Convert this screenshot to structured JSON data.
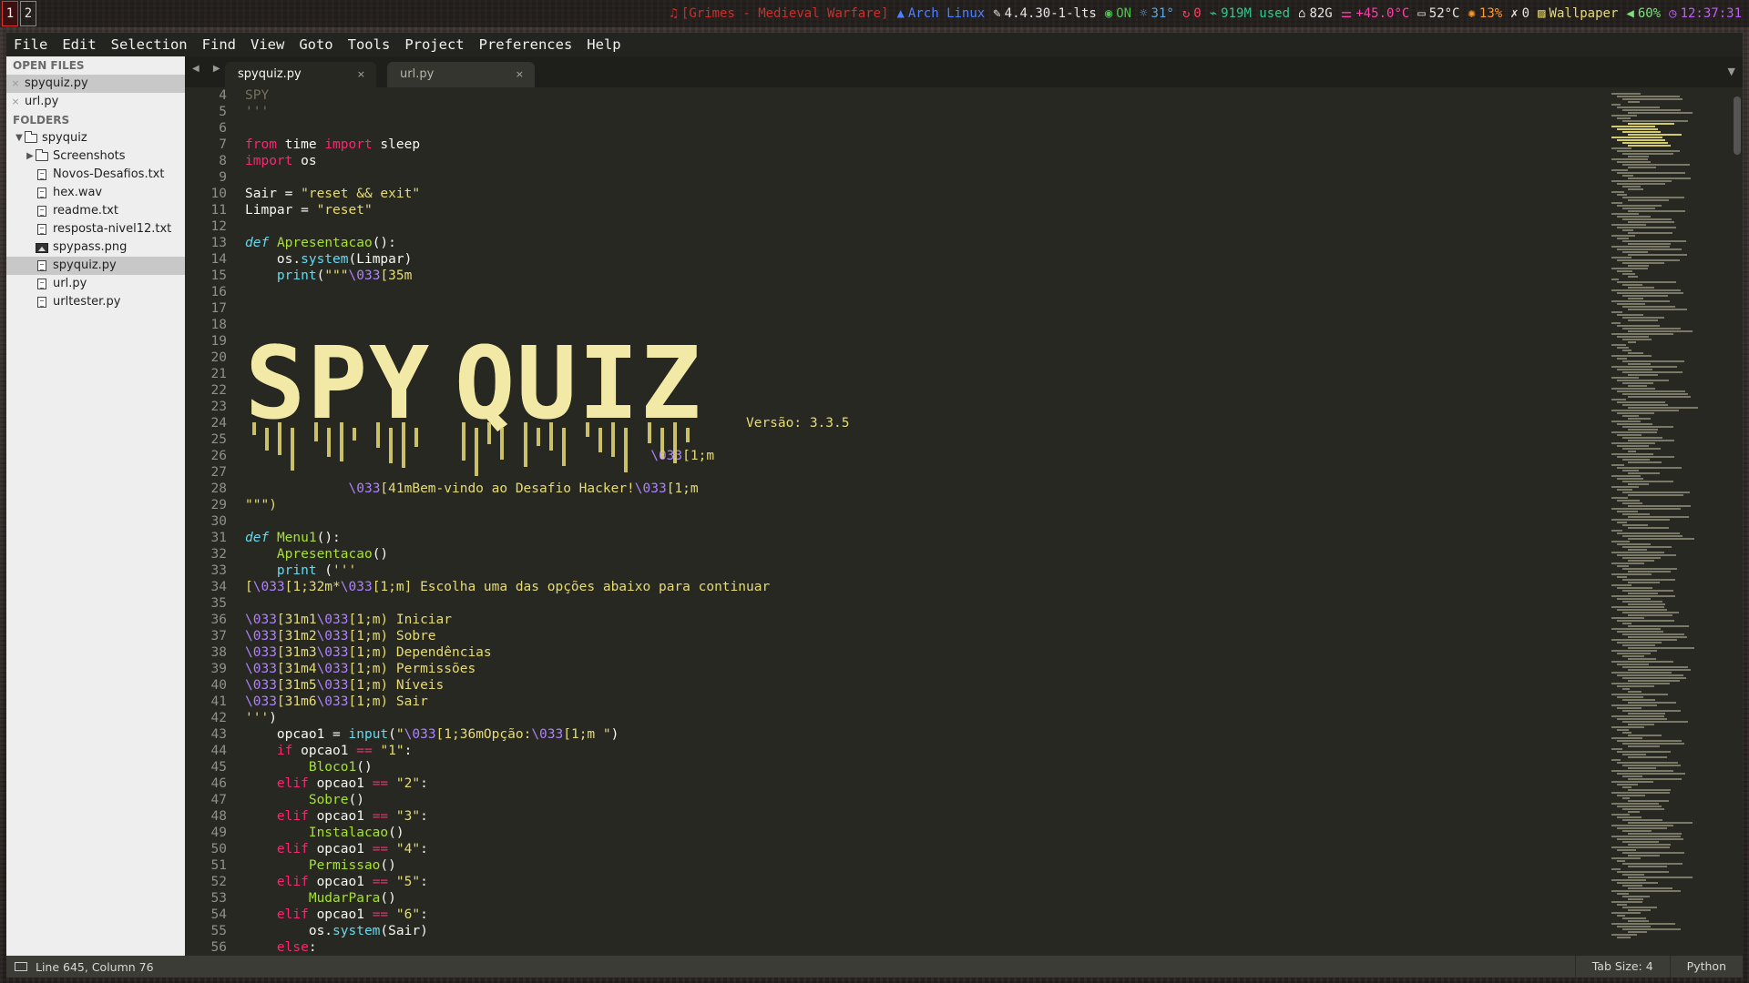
{
  "workspaces": [
    "1",
    "2"
  ],
  "status_bar": [
    {
      "icon": "music-icon",
      "glyph": "♫",
      "text": "[Grimes - Medieval Warfare]",
      "color": "#c9302c"
    },
    {
      "icon": "arch-logo-icon",
      "glyph": "▲",
      "text": "Arch Linux",
      "color": "#4d7fff"
    },
    {
      "icon": "wrench-icon",
      "glyph": "✎",
      "text": "4.4.30-1-lts",
      "color": "#e6e6e6"
    },
    {
      "icon": "globe-icon",
      "glyph": "◉",
      "text": "ON",
      "color": "#4cc34c"
    },
    {
      "icon": "weather-icon",
      "glyph": "☼",
      "text": "31°",
      "color": "#5aa7e0"
    },
    {
      "icon": "updates-icon",
      "glyph": "↻",
      "text": "0",
      "color": "#ff3f5f"
    },
    {
      "icon": "memory-icon",
      "glyph": "⌁",
      "text": "919M used",
      "color": "#35c68a"
    },
    {
      "icon": "home-icon",
      "glyph": "⌂",
      "text": "82G",
      "color": "#e6e6e6"
    },
    {
      "icon": "thermometer-icon",
      "glyph": "⚌",
      "text": "+45.0°C",
      "color": "#ff3fa9"
    },
    {
      "icon": "monitor-icon",
      "glyph": "▭",
      "text": "52°C",
      "color": "#e6e6e6"
    },
    {
      "icon": "cpu-icon",
      "glyph": "✺",
      "text": "13%",
      "color": "#ff9a2e"
    },
    {
      "icon": "trash-icon",
      "glyph": "✗",
      "text": "0",
      "color": "#e6e6e6"
    },
    {
      "icon": "wallpaper-icon",
      "glyph": "▨",
      "text": "Wallpaper",
      "color": "#e6db74"
    },
    {
      "icon": "volume-icon",
      "glyph": "◀",
      "text": "60%",
      "color": "#7ee07e"
    },
    {
      "icon": "clock-icon",
      "glyph": "◷",
      "text": "12:37:31",
      "color": "#c05ef5"
    }
  ],
  "menu": [
    "File",
    "Edit",
    "Selection",
    "Find",
    "View",
    "Goto",
    "Tools",
    "Project",
    "Preferences",
    "Help"
  ],
  "sidebar": {
    "open_files_label": "OPEN FILES",
    "open_files": [
      {
        "name": "spyquiz.py",
        "selected": true
      },
      {
        "name": "url.py",
        "selected": false
      }
    ],
    "folders_label": "FOLDERS",
    "root_folder": "spyquiz",
    "items": [
      {
        "name": "Screenshots",
        "type": "folder",
        "selected": false
      },
      {
        "name": "Novos-Desafios.txt",
        "type": "file",
        "selected": false
      },
      {
        "name": "hex.wav",
        "type": "file",
        "selected": false
      },
      {
        "name": "readme.txt",
        "type": "file",
        "selected": false
      },
      {
        "name": "resposta-nivel12.txt",
        "type": "file",
        "selected": false
      },
      {
        "name": "spypass.png",
        "type": "image",
        "selected": false
      },
      {
        "name": "spyquiz.py",
        "type": "file",
        "selected": true
      },
      {
        "name": "url.py",
        "type": "file",
        "selected": false
      },
      {
        "name": "urltester.py",
        "type": "file",
        "selected": false
      }
    ]
  },
  "tabs": [
    {
      "label": "spyquiz.py",
      "close": "×",
      "active": true
    },
    {
      "label": "url.py",
      "close": "×",
      "active": false
    }
  ],
  "tab_nav": "◀ ▶",
  "tab_menu": "▼",
  "ascii_art": {
    "text": "SPY QUIZ",
    "color": "#f3e9a6"
  },
  "code_lines": [
    {
      "n": 4,
      "tokens": [
        [
          "cm",
          "SPY"
        ]
      ]
    },
    {
      "n": 5,
      "tokens": [
        [
          "cm",
          "'''"
        ]
      ]
    },
    {
      "n": 6,
      "tokens": []
    },
    {
      "n": 7,
      "tokens": [
        [
          "kw",
          "from"
        ],
        [
          "plain",
          " time "
        ],
        [
          "kw",
          "import"
        ],
        [
          "plain",
          " sleep"
        ]
      ]
    },
    {
      "n": 8,
      "tokens": [
        [
          "kw",
          "import"
        ],
        [
          "plain",
          " os"
        ]
      ]
    },
    {
      "n": 9,
      "tokens": []
    },
    {
      "n": 10,
      "tokens": [
        [
          "plain",
          "Sair = "
        ],
        [
          "str",
          "\"reset && exit\""
        ]
      ]
    },
    {
      "n": 11,
      "tokens": [
        [
          "plain",
          "Limpar = "
        ],
        [
          "str",
          "\"reset\""
        ]
      ]
    },
    {
      "n": 12,
      "tokens": []
    },
    {
      "n": 13,
      "tokens": [
        [
          "def",
          "def"
        ],
        [
          "plain",
          " "
        ],
        [
          "fn",
          "Apresentacao"
        ],
        [
          "plain",
          "():"
        ]
      ]
    },
    {
      "n": 14,
      "tokens": [
        [
          "plain",
          "    os."
        ],
        [
          "bi",
          "system"
        ],
        [
          "plain",
          "(Limpar)"
        ]
      ]
    },
    {
      "n": 15,
      "tokens": [
        [
          "plain",
          "    "
        ],
        [
          "bi",
          "print"
        ],
        [
          "plain",
          "("
        ],
        [
          "str",
          "\"\"\""
        ],
        [
          "esc",
          "\\033"
        ],
        [
          "str",
          "[35m"
        ]
      ]
    },
    {
      "n": 16,
      "tokens": []
    },
    {
      "n": 17,
      "tokens": []
    },
    {
      "n": 18,
      "tokens": []
    },
    {
      "n": 19,
      "tokens": []
    },
    {
      "n": 20,
      "tokens": []
    },
    {
      "n": 21,
      "tokens": []
    },
    {
      "n": 22,
      "tokens": []
    },
    {
      "n": 23,
      "tokens": []
    },
    {
      "n": 24,
      "tokens": [
        [
          "plain",
          "                                                               "
        ],
        [
          "str",
          "Versão: 3.3.5"
        ]
      ]
    },
    {
      "n": 25,
      "tokens": []
    },
    {
      "n": 26,
      "tokens": [
        [
          "plain",
          "                                                   "
        ],
        [
          "esc",
          "\\033"
        ],
        [
          "str",
          "[1;m"
        ]
      ]
    },
    {
      "n": 27,
      "tokens": []
    },
    {
      "n": 28,
      "tokens": [
        [
          "plain",
          "             "
        ],
        [
          "esc",
          "\\033"
        ],
        [
          "str",
          "[41mBem-vindo ao Desafio Hacker!"
        ],
        [
          "esc",
          "\\033"
        ],
        [
          "str",
          "[1;m"
        ]
      ]
    },
    {
      "n": 29,
      "tokens": [
        [
          "str",
          "\"\"\")"
        ]
      ]
    },
    {
      "n": 30,
      "tokens": []
    },
    {
      "n": 31,
      "tokens": [
        [
          "def",
          "def"
        ],
        [
          "plain",
          " "
        ],
        [
          "fn",
          "Menu1"
        ],
        [
          "plain",
          "():"
        ]
      ]
    },
    {
      "n": 32,
      "tokens": [
        [
          "plain",
          "    "
        ],
        [
          "fn",
          "Apresentacao"
        ],
        [
          "plain",
          "()"
        ]
      ]
    },
    {
      "n": 33,
      "tokens": [
        [
          "plain",
          "    "
        ],
        [
          "bi",
          "print"
        ],
        [
          "plain",
          " ("
        ],
        [
          "str",
          "'''"
        ]
      ]
    },
    {
      "n": 34,
      "tokens": [
        [
          "str",
          "["
        ],
        [
          "esc",
          "\\033"
        ],
        [
          "str",
          "[1;32m*"
        ],
        [
          "esc",
          "\\033"
        ],
        [
          "str",
          "[1;m] Escolha uma das opções abaixo para continuar"
        ]
      ]
    },
    {
      "n": 35,
      "tokens": []
    },
    {
      "n": 36,
      "tokens": [
        [
          "esc",
          "\\033"
        ],
        [
          "str",
          "[31m1"
        ],
        [
          "esc",
          "\\033"
        ],
        [
          "str",
          "[1;m) Iniciar"
        ]
      ]
    },
    {
      "n": 37,
      "tokens": [
        [
          "esc",
          "\\033"
        ],
        [
          "str",
          "[31m2"
        ],
        [
          "esc",
          "\\033"
        ],
        [
          "str",
          "[1;m) Sobre"
        ]
      ]
    },
    {
      "n": 38,
      "tokens": [
        [
          "esc",
          "\\033"
        ],
        [
          "str",
          "[31m3"
        ],
        [
          "esc",
          "\\033"
        ],
        [
          "str",
          "[1;m) Dependências"
        ]
      ]
    },
    {
      "n": 39,
      "tokens": [
        [
          "esc",
          "\\033"
        ],
        [
          "str",
          "[31m4"
        ],
        [
          "esc",
          "\\033"
        ],
        [
          "str",
          "[1;m) Permissões"
        ]
      ]
    },
    {
      "n": 40,
      "tokens": [
        [
          "esc",
          "\\033"
        ],
        [
          "str",
          "[31m5"
        ],
        [
          "esc",
          "\\033"
        ],
        [
          "str",
          "[1;m) Níveis"
        ]
      ]
    },
    {
      "n": 41,
      "tokens": [
        [
          "esc",
          "\\033"
        ],
        [
          "str",
          "[31m6"
        ],
        [
          "esc",
          "\\033"
        ],
        [
          "str",
          "[1;m) Sair"
        ]
      ]
    },
    {
      "n": 42,
      "tokens": [
        [
          "str",
          "'''"
        ],
        [
          "plain",
          ")"
        ]
      ]
    },
    {
      "n": 43,
      "tokens": [
        [
          "plain",
          "    opcao1 = "
        ],
        [
          "bi",
          "input"
        ],
        [
          "plain",
          "("
        ],
        [
          "str",
          "\""
        ],
        [
          "esc",
          "\\033"
        ],
        [
          "str",
          "[1;36mOpção:"
        ],
        [
          "esc",
          "\\033"
        ],
        [
          "str",
          "[1;m \""
        ],
        [
          "plain",
          ")"
        ]
      ]
    },
    {
      "n": 44,
      "tokens": [
        [
          "plain",
          "    "
        ],
        [
          "kw",
          "if"
        ],
        [
          "plain",
          " opcao1 "
        ],
        [
          "kw",
          "=="
        ],
        [
          "plain",
          " "
        ],
        [
          "str",
          "\"1\""
        ],
        [
          "plain",
          ":"
        ]
      ]
    },
    {
      "n": 45,
      "tokens": [
        [
          "plain",
          "        "
        ],
        [
          "fn",
          "Bloco1"
        ],
        [
          "plain",
          "()"
        ]
      ]
    },
    {
      "n": 46,
      "tokens": [
        [
          "plain",
          "    "
        ],
        [
          "kw",
          "elif"
        ],
        [
          "plain",
          " opcao1 "
        ],
        [
          "kw",
          "=="
        ],
        [
          "plain",
          " "
        ],
        [
          "str",
          "\"2\""
        ],
        [
          "plain",
          ":"
        ]
      ]
    },
    {
      "n": 47,
      "tokens": [
        [
          "plain",
          "        "
        ],
        [
          "fn",
          "Sobre"
        ],
        [
          "plain",
          "()"
        ]
      ]
    },
    {
      "n": 48,
      "tokens": [
        [
          "plain",
          "    "
        ],
        [
          "kw",
          "elif"
        ],
        [
          "plain",
          " opcao1 "
        ],
        [
          "kw",
          "=="
        ],
        [
          "plain",
          " "
        ],
        [
          "str",
          "\"3\""
        ],
        [
          "plain",
          ":"
        ]
      ]
    },
    {
      "n": 49,
      "tokens": [
        [
          "plain",
          "        "
        ],
        [
          "fn",
          "Instalacao"
        ],
        [
          "plain",
          "()"
        ]
      ]
    },
    {
      "n": 50,
      "tokens": [
        [
          "plain",
          "    "
        ],
        [
          "kw",
          "elif"
        ],
        [
          "plain",
          " opcao1 "
        ],
        [
          "kw",
          "=="
        ],
        [
          "plain",
          " "
        ],
        [
          "str",
          "\"4\""
        ],
        [
          "plain",
          ":"
        ]
      ]
    },
    {
      "n": 51,
      "tokens": [
        [
          "plain",
          "        "
        ],
        [
          "fn",
          "Permissao"
        ],
        [
          "plain",
          "()"
        ]
      ]
    },
    {
      "n": 52,
      "tokens": [
        [
          "plain",
          "    "
        ],
        [
          "kw",
          "elif"
        ],
        [
          "plain",
          " opcao1 "
        ],
        [
          "kw",
          "=="
        ],
        [
          "plain",
          " "
        ],
        [
          "str",
          "\"5\""
        ],
        [
          "plain",
          ":"
        ]
      ]
    },
    {
      "n": 53,
      "tokens": [
        [
          "plain",
          "        "
        ],
        [
          "fn",
          "MudarPara"
        ],
        [
          "plain",
          "()"
        ]
      ]
    },
    {
      "n": 54,
      "tokens": [
        [
          "plain",
          "    "
        ],
        [
          "kw",
          "elif"
        ],
        [
          "plain",
          " opcao1 "
        ],
        [
          "kw",
          "=="
        ],
        [
          "plain",
          " "
        ],
        [
          "str",
          "\"6\""
        ],
        [
          "plain",
          ":"
        ]
      ]
    },
    {
      "n": 55,
      "tokens": [
        [
          "plain",
          "        os."
        ],
        [
          "bi",
          "system"
        ],
        [
          "plain",
          "(Sair)"
        ]
      ]
    },
    {
      "n": 56,
      "tokens": [
        [
          "plain",
          "    "
        ],
        [
          "kw",
          "else"
        ],
        [
          "plain",
          ":"
        ]
      ]
    }
  ],
  "bottom": {
    "position": "Line 645, Column 76",
    "tab_size": "Tab Size: 4",
    "syntax": "Python"
  },
  "colors": {
    "background": "#272822",
    "keyword": "#f92672",
    "string": "#e6db74",
    "function": "#a6e22e",
    "builtin": "#66d9ef",
    "escape": "#ae81ff",
    "comment": "#75715e"
  }
}
